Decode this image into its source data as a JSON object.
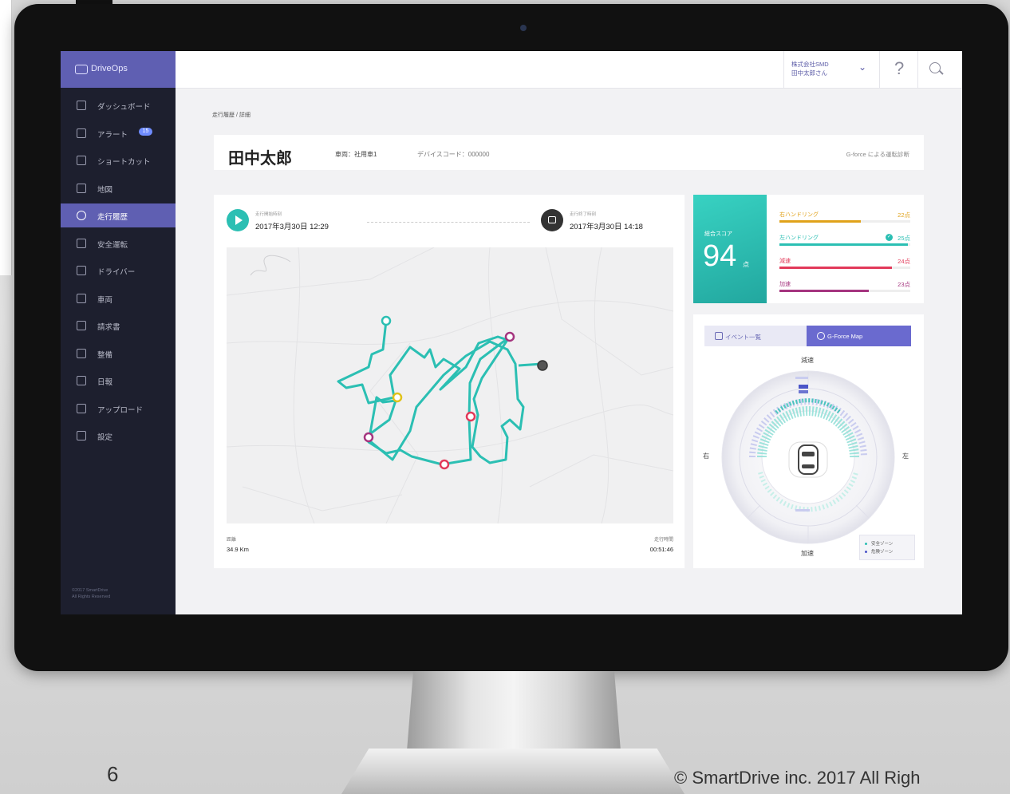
{
  "app": {
    "name": "DriveOps",
    "copyright_lines": [
      "©2017 SmartDrive",
      "All Rights Reserved"
    ]
  },
  "sidebar": {
    "items": [
      {
        "label": "ダッシュボード",
        "icon": "dashboard-icon"
      },
      {
        "label": "アラート",
        "icon": "alert-icon",
        "badge": "15"
      },
      {
        "label": "ショートカット",
        "icon": "shortcut-icon"
      },
      {
        "label": "地図",
        "icon": "map-icon"
      },
      {
        "label": "走行履歴",
        "icon": "steering-wheel-icon",
        "active": true
      },
      {
        "label": "安全運転",
        "icon": "check-circle-icon"
      },
      {
        "label": "ドライバー",
        "icon": "driver-icon"
      },
      {
        "label": "車両",
        "icon": "car-icon"
      },
      {
        "label": "請求書",
        "icon": "invoice-icon"
      },
      {
        "label": "整備",
        "icon": "maintenance-icon"
      },
      {
        "label": "日報",
        "icon": "calendar-icon"
      },
      {
        "label": "アップロード",
        "icon": "upload-icon"
      },
      {
        "label": "設定",
        "icon": "settings-icon"
      }
    ]
  },
  "header": {
    "company_line1": "株式会社SMD",
    "company_line2": "田中太郎さん",
    "help": "?"
  },
  "breadcrumb": "走行履歴 / 詳細",
  "title_card": {
    "driver_name": "田中太郎",
    "vehicle": "車両：社用車1",
    "device": "デバイスコード：000000",
    "gforce_link": "G-force による運転診断"
  },
  "trip": {
    "start_label": "走行開始時刻",
    "start_time": "2017年3月30日 12:29",
    "end_label": "走行終了時刻",
    "end_time": "2017年3月30日 14:18",
    "distance_label": "距離",
    "distance": "34.9 Km",
    "duration_label": "走行時間",
    "duration": "00:51:46"
  },
  "score": {
    "label": "総合スコア",
    "value": "94",
    "unit": "点",
    "rows": [
      {
        "name": "右ハンドリング",
        "value": "22点",
        "fraction": 0.62,
        "color": "#e0a21a"
      },
      {
        "name": "左ハンドリング",
        "value": "25点",
        "fraction": 0.98,
        "color": "#2bbfb3",
        "checked": true
      },
      {
        "name": "減速",
        "value": "24点",
        "fraction": 0.86,
        "color": "#e23a5a"
      },
      {
        "name": "加速",
        "value": "23点",
        "fraction": 0.68,
        "color": "#a5357f"
      }
    ]
  },
  "gforce": {
    "tab_events": "イベント一覧",
    "tab_gmap": "G-Force Map",
    "dir_top": "減速",
    "dir_bottom": "加速",
    "dir_right_side": "右",
    "dir_left_side": "左",
    "legend_safe": "安全ゾーン",
    "legend_danger": "危険ゾーン",
    "colors": {
      "safe": "#2bbfb3",
      "danger": "#4b55c8"
    }
  },
  "footer": {
    "page_number": "6",
    "copyright": "© SmartDrive inc. 2017 All Righ"
  }
}
